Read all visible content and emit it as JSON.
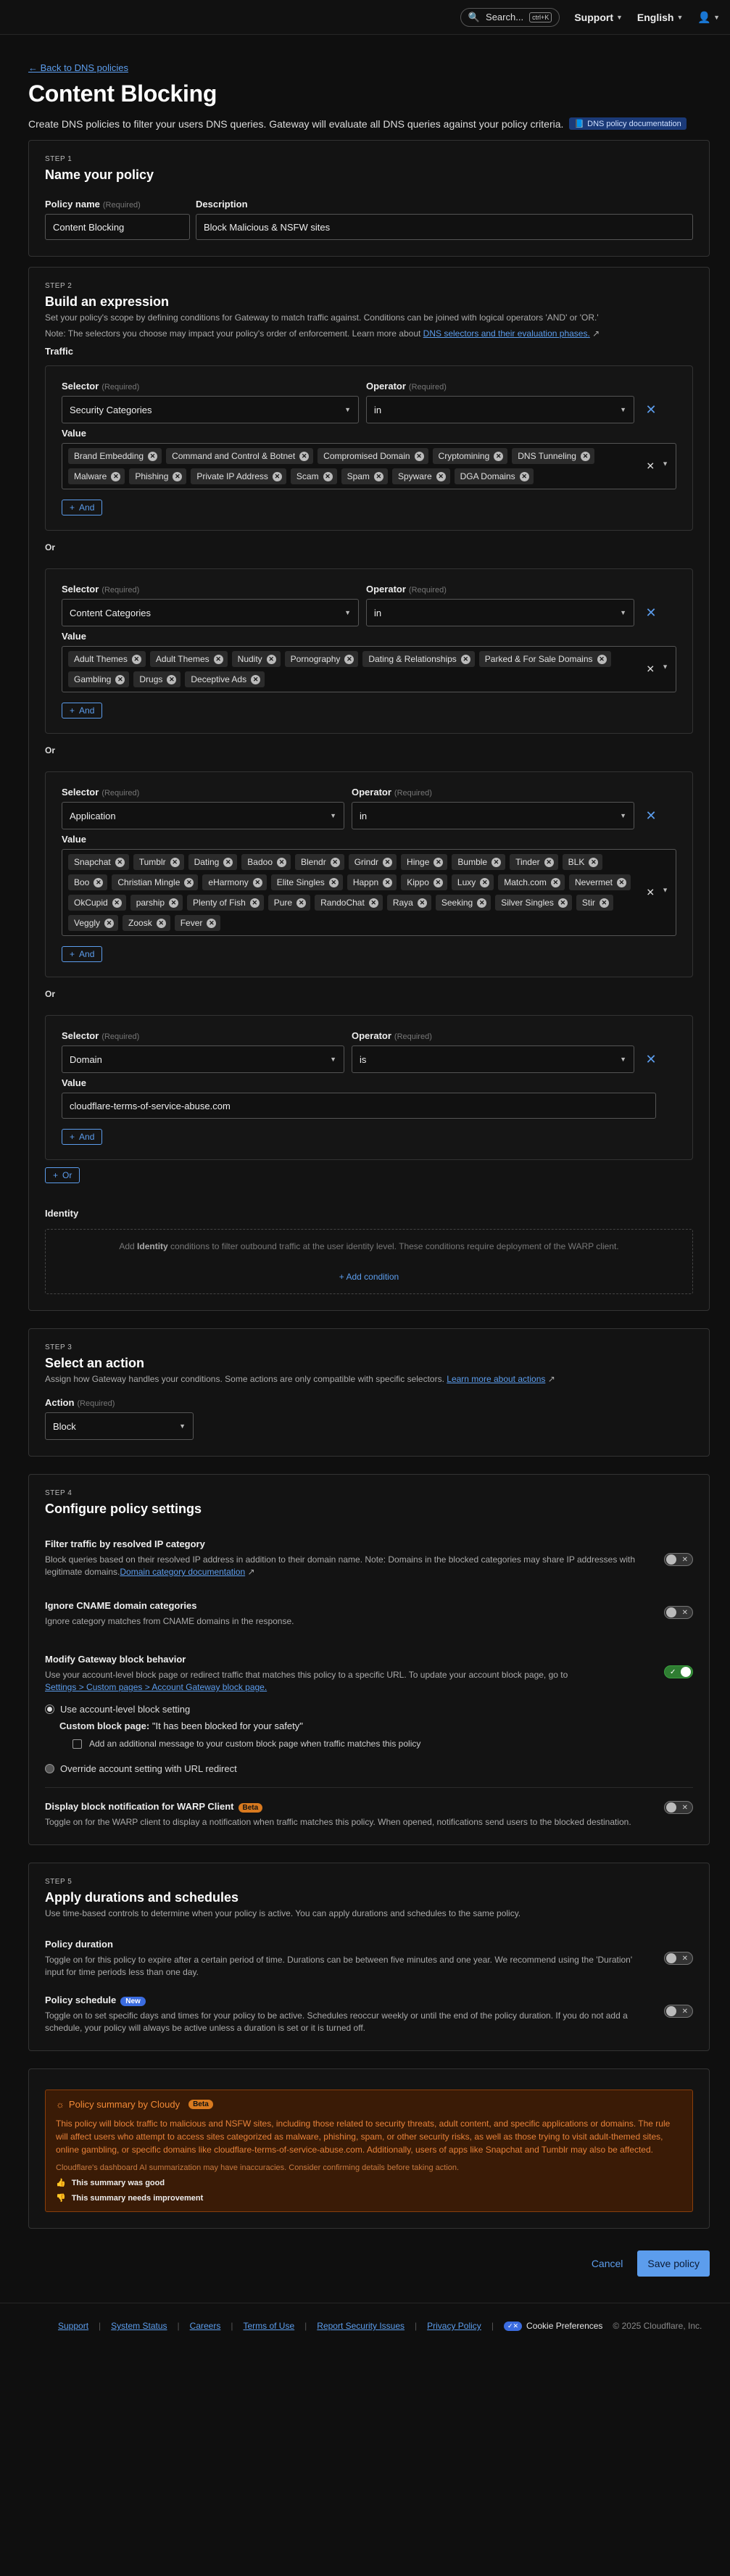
{
  "topbar": {
    "search_label": "Search...",
    "search_shortcut": "ctrl+K",
    "support_label": "Support",
    "language_label": "English"
  },
  "back_link": "← Back to DNS policies",
  "page_title": "Content Blocking",
  "page_subtitle": "Create DNS policies to filter your users DNS queries. Gateway will evaluate all DNS queries against your policy criteria.",
  "doc_badge": "DNS policy documentation",
  "step1": {
    "step": "STEP 1",
    "title": "Name your policy",
    "policy_name_label": "Policy name",
    "policy_name_req": "(Required)",
    "policy_name_value": "Content Blocking",
    "description_label": "Description",
    "description_value": "Block Malicious & NSFW sites"
  },
  "step2": {
    "step": "STEP 2",
    "title": "Build an expression",
    "desc": "Set your policy's scope by defining conditions for Gateway to match traffic against. Conditions can be joined with logical operators 'AND' or 'OR.'",
    "note_prefix": "Note: The selectors you choose may impact your policy's order of enforcement. Learn more about ",
    "note_link": "DNS selectors and their evaluation phases.",
    "traffic_label": "Traffic",
    "selector_label": "Selector",
    "operator_label": "Operator",
    "required": "(Required)",
    "value_label": "Value",
    "and_label": "And",
    "or_label": "Or",
    "or_button": "Or",
    "groups": [
      {
        "selector": "Security Categories",
        "operator": "in",
        "values": [
          "Brand Embedding",
          "Command and Control & Botnet",
          "Compromised Domain",
          "Cryptomining",
          "DNS Tunneling",
          "Malware",
          "Phishing",
          "Private IP Address",
          "Scam",
          "Spam",
          "Spyware",
          "DGA Domains"
        ]
      },
      {
        "selector": "Content Categories",
        "operator": "in",
        "values": [
          "Adult Themes",
          "Adult Themes",
          "Nudity",
          "Pornography",
          "Dating & Relationships",
          "Parked & For Sale Domains",
          "Gambling",
          "Drugs",
          "Deceptive Ads"
        ]
      },
      {
        "selector": "Application",
        "operator": "in",
        "values": [
          "Snapchat",
          "Tumblr",
          "Dating",
          "Badoo",
          "Blendr",
          "Grindr",
          "Hinge",
          "Bumble",
          "Tinder",
          "BLK",
          "Boo",
          "Christian Mingle",
          "eHarmony",
          "Elite Singles",
          "Happn",
          "Kippo",
          "Luxy",
          "Match.com",
          "Nevermet",
          "OkCupid",
          "parship",
          "Plenty of Fish",
          "Pure",
          "RandoChat",
          "Raya",
          "Seeking",
          "Silver Singles",
          "Stir",
          "Veggly",
          "Zoosk",
          "Fever"
        ]
      },
      {
        "selector": "Domain",
        "operator": "is",
        "text_value": "cloudflare-terms-of-service-abuse.com"
      }
    ],
    "identity_label": "Identity",
    "identity_hint_pre": "Add ",
    "identity_hint_bold": "Identity",
    "identity_hint_post": " conditions to filter outbound traffic at the user identity level. These conditions require deployment of the WARP client.",
    "add_condition": "+ Add condition"
  },
  "step3": {
    "step": "STEP 3",
    "title": "Select an action",
    "desc": "Assign how Gateway handles your conditions. Some actions are only compatible with specific selectors. ",
    "desc_link": "Learn more about actions",
    "action_label": "Action",
    "action_value": "Block"
  },
  "step4": {
    "step": "STEP 4",
    "title": "Configure policy settings",
    "s1_title": "Filter traffic by resolved IP category",
    "s1_desc": "Block queries based on their resolved IP address in addition to their domain name. Note: Domains in the blocked categories may share IP addresses with legitimate domains.",
    "s1_link": "Domain category documentation",
    "s2_title": "Ignore CNAME domain categories",
    "s2_desc": "Ignore category matches from CNAME domains in the response.",
    "s3_title": "Modify Gateway block behavior",
    "s3_desc": "Use your account-level block page or redirect traffic that matches this policy to a specific URL. To update your account block page, go to",
    "s3_link": "Settings > Custom pages > Account Gateway block page.",
    "radio1": "Use account-level block setting",
    "custom_block_label": "Custom block page:",
    "custom_block_value": "\"It has been blocked for your safety\"",
    "add_message": "Add an additional message to your custom block page when traffic matches this policy",
    "radio2": "Override account setting with URL redirect",
    "s4_title": "Display block notification for WARP Client",
    "s4_badge": "Beta",
    "s4_desc": "Toggle on for the WARP client to display a notification when traffic matches this policy. When opened, notifications send users to the blocked destination."
  },
  "step5": {
    "step": "STEP 5",
    "title": "Apply durations and schedules",
    "desc": "Use time-based controls to determine when your policy is active. You can apply durations and schedules to the same policy.",
    "d_title": "Policy duration",
    "d_desc": "Toggle on for this policy to expire after a certain period of time. Durations can be between five minutes and one year. We recommend using the 'Duration' input for time periods less than one day.",
    "s_title": "Policy schedule",
    "s_badge": "New",
    "s_desc": "Toggle on to set specific days and times for your policy to be active. Schedules reoccur weekly or until the end of the policy duration. If you do not add a schedule, your policy will always be active unless a duration is set or it is turned off."
  },
  "summary": {
    "title": "Policy summary by Cloudy",
    "badge": "Beta",
    "text": "This policy will block traffic to malicious and NSFW sites, including those related to security threats, adult content, and specific applications or domains. The rule will affect users who attempt to access sites categorized as malware, phishing, spam, or other security risks, as well as those trying to visit adult-themed sites, online gambling, or specific domains like cloudflare-terms-of-service-abuse.com. Additionally, users of apps like Snapchat and Tumblr may also be affected.",
    "disclaimer": "Cloudflare's dashboard AI summarization may have inaccuracies. Consider confirming details before taking action.",
    "good": "This summary was good",
    "bad": "This summary needs improvement"
  },
  "actions": {
    "cancel": "Cancel",
    "save": "Save policy"
  },
  "footer": {
    "links": [
      "Support",
      "System Status",
      "Careers",
      "Terms of Use",
      "Report Security Issues",
      "Privacy Policy"
    ],
    "cookie": "Cookie Preferences",
    "copyright": "© 2025 Cloudflare, Inc."
  }
}
